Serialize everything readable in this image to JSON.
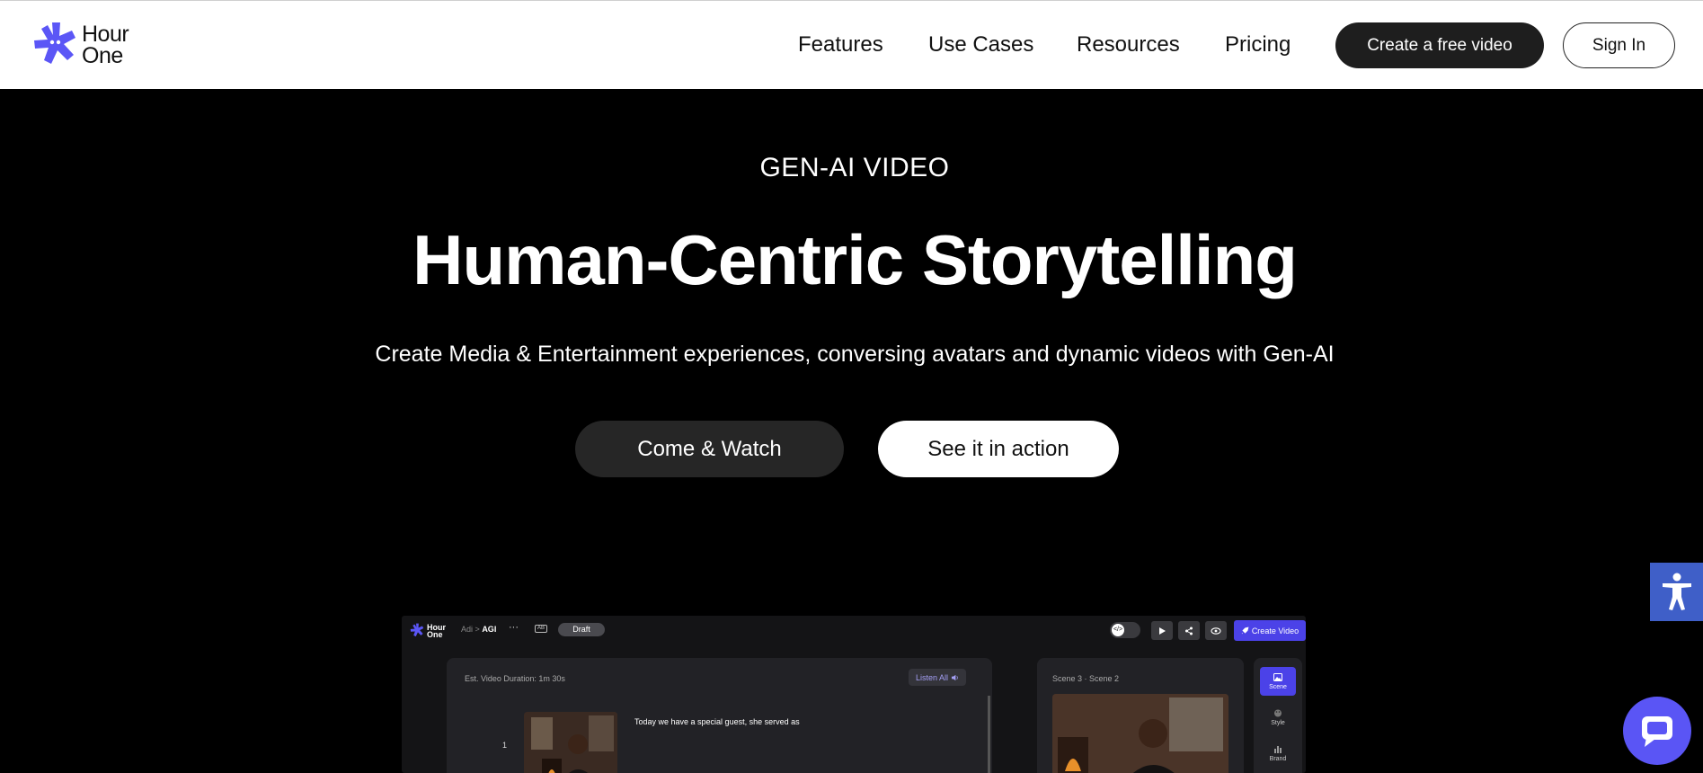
{
  "brand": {
    "name_line1": "Hour",
    "name_line2": "One",
    "accent": "#5b56f6"
  },
  "nav": {
    "items": [
      "Features",
      "Use Cases",
      "Resources",
      "Pricing"
    ],
    "cta_create": "Create a free video",
    "cta_signin": "Sign In"
  },
  "hero": {
    "eyebrow": "GEN-AI VIDEO",
    "title": "Human-Centric Storytelling",
    "subtitle": "Create Media & Entertainment experiences, conversing avatars and dynamic videos with Gen-AI",
    "btn_watch": "Come & Watch",
    "btn_action": "See it in action"
  },
  "app_preview": {
    "logo_line1": "Hour",
    "logo_line2": "One",
    "crumb_parent": "Adi",
    "crumb_sep": ">",
    "crumb_current": "AGI",
    "dots": "···",
    "cc_badge": "AB",
    "status": "Draft",
    "toggle_glyph": "</>",
    "create_video": "Create Video",
    "duration": "Est. Video Duration: 1m 30s",
    "listen_all": "Listen All",
    "scene_number": "1",
    "scene_text": "Today we have a special guest, she served as",
    "scene_label": "Scene 3 · Scene 2",
    "tools": [
      "Scene",
      "Style",
      "Brand"
    ]
  },
  "widgets": {
    "a11y_color": "#3f5fc8",
    "chat_color": "#5a55f5"
  }
}
